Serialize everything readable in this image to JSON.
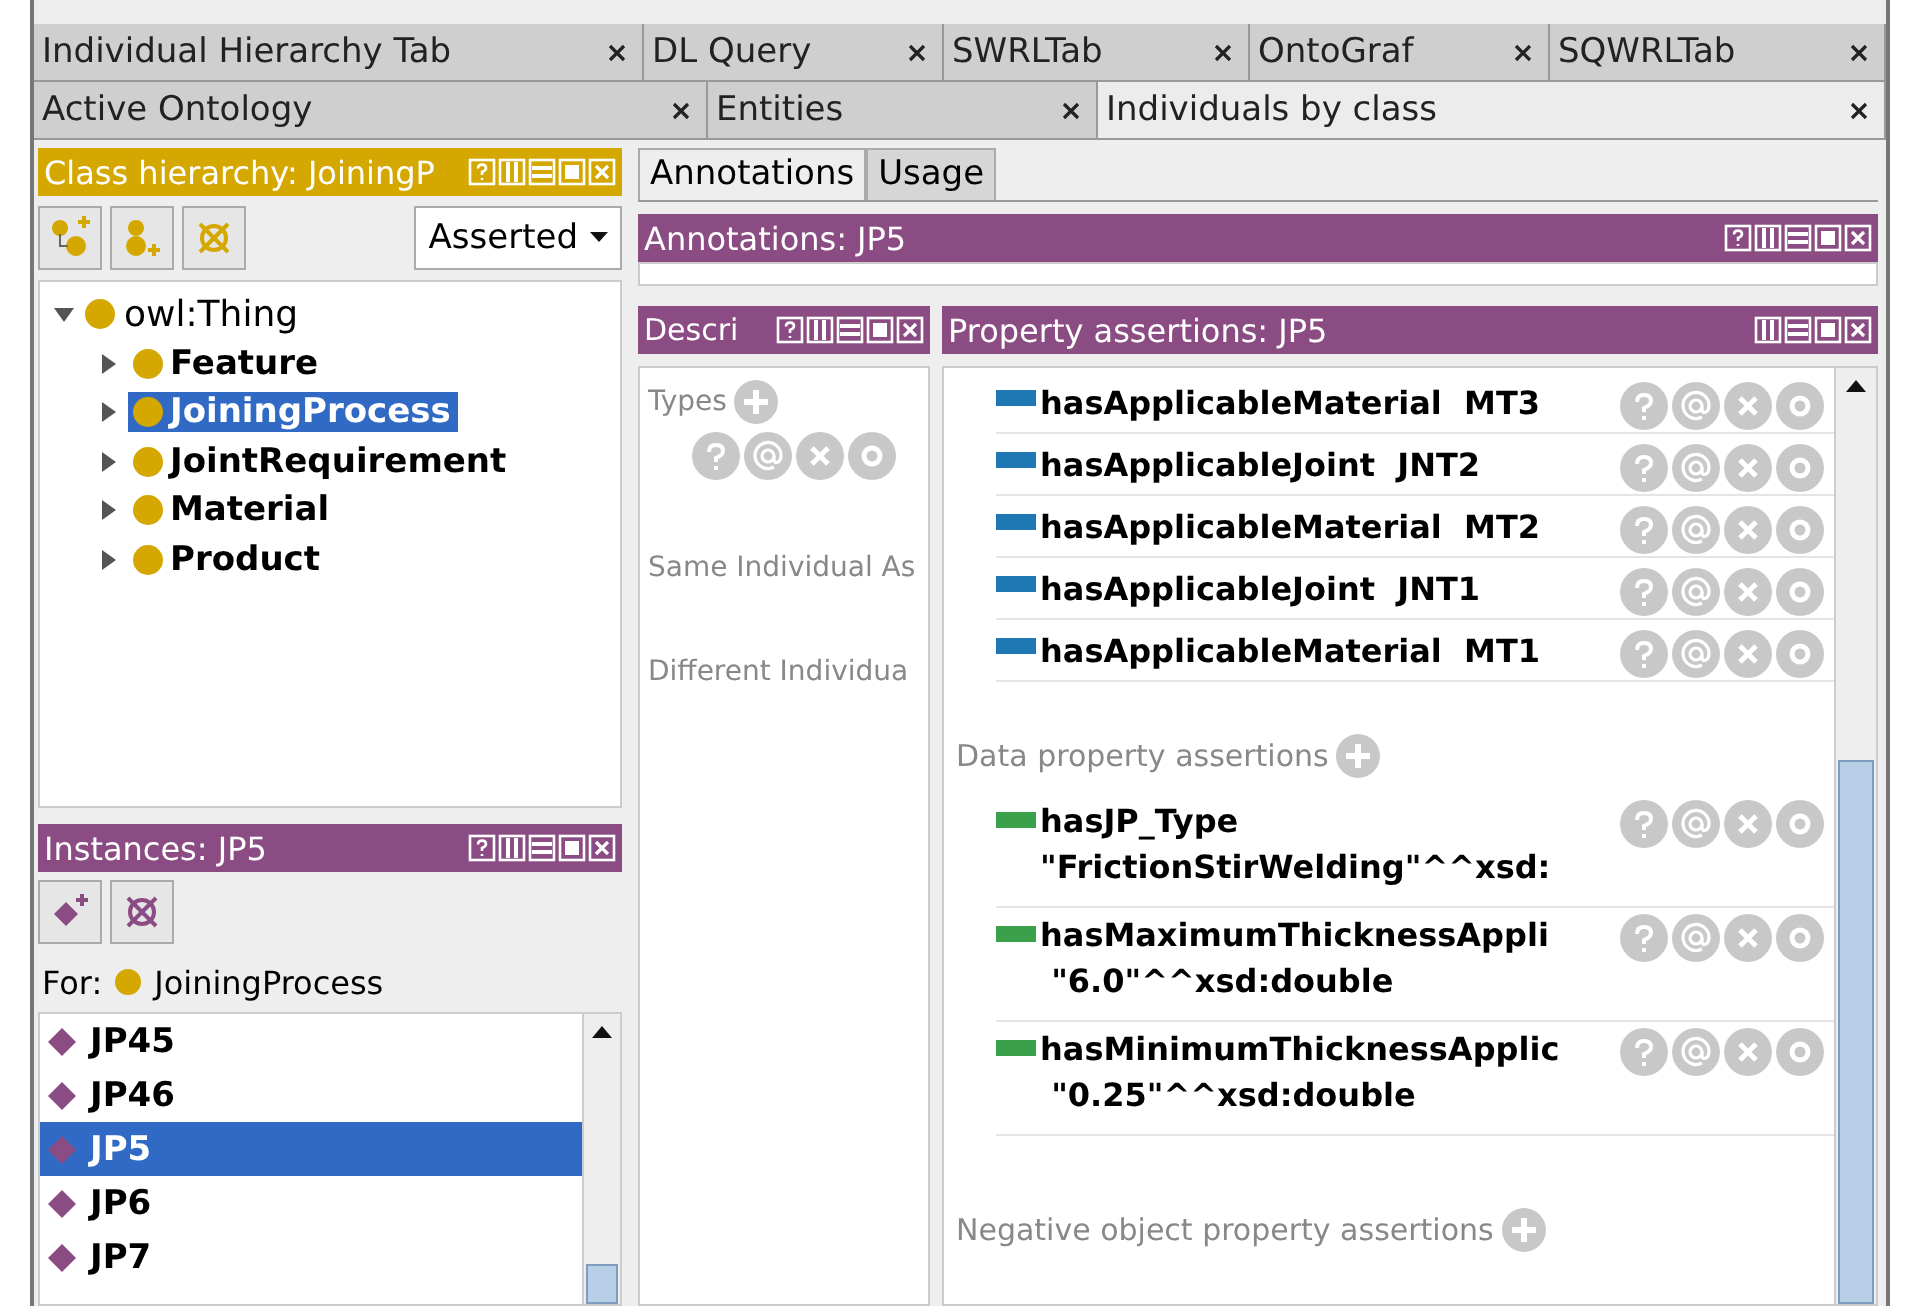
{
  "tab_rows": [
    [
      {
        "label": "Individual Hierarchy Tab",
        "selected": false
      },
      {
        "label": "DL Query",
        "selected": false
      },
      {
        "label": "SWRLTab",
        "selected": false
      },
      {
        "label": "OntoGraf",
        "selected": false
      },
      {
        "label": "SQWRLTab",
        "selected": false
      }
    ],
    [
      {
        "label": "Active Ontology",
        "selected": false
      },
      {
        "label": "Entities",
        "selected": false
      },
      {
        "label": "Individuals by class",
        "selected": true
      }
    ]
  ],
  "class_hierarchy": {
    "title": "Class hierarchy: JoiningP",
    "view_mode": "Asserted",
    "root": {
      "label": "owl:Thing",
      "expanded": true,
      "children": [
        {
          "label": "Feature",
          "selected": false,
          "expanded": false
        },
        {
          "label": "JoiningProcess",
          "selected": true,
          "expanded": false
        },
        {
          "label": "JointRequirement",
          "selected": false,
          "expanded": false
        },
        {
          "label": "Material",
          "selected": false,
          "expanded": false
        },
        {
          "label": "Product",
          "selected": false,
          "expanded": false
        }
      ]
    }
  },
  "instances": {
    "title": "Instances: JP5",
    "for_label": "For:",
    "for_class": "JoiningProcess",
    "items": [
      {
        "label": "JP45",
        "selected": false
      },
      {
        "label": "JP46",
        "selected": false
      },
      {
        "label": "JP5",
        "selected": true
      },
      {
        "label": "JP6",
        "selected": false
      },
      {
        "label": "JP7",
        "selected": false
      }
    ]
  },
  "detail_tabs": [
    {
      "label": "Annotations",
      "selected": true
    },
    {
      "label": "Usage",
      "selected": false
    }
  ],
  "annotations": {
    "title": "Annotations: JP5"
  },
  "description": {
    "title": "Descri",
    "types_label": "Types",
    "same_label": "Same Individual As",
    "different_label": "Different Individua"
  },
  "property_assertions": {
    "title": "Property assertions: JP5",
    "object_properties": [
      {
        "property": "hasApplicableMaterial",
        "value": "MT3"
      },
      {
        "property": "hasApplicableJoint",
        "value": "JNT2"
      },
      {
        "property": "hasApplicableMaterial",
        "value": "MT2"
      },
      {
        "property": "hasApplicableJoint",
        "value": "JNT1"
      },
      {
        "property": "hasApplicableMaterial",
        "value": "MT1"
      }
    ],
    "data_heading": "Data property assertions",
    "data_properties": [
      {
        "property": "hasJP_Type",
        "value": "\"FrictionStirWelding\"^^xsd:"
      },
      {
        "property": "hasMaximumThicknessAppli",
        "value": " \"6.0\"^^xsd:double"
      },
      {
        "property": "hasMinimumThicknessApplic",
        "value": " \"0.25\"^^xsd:double"
      }
    ],
    "negative_heading": "Negative object property assertions"
  }
}
